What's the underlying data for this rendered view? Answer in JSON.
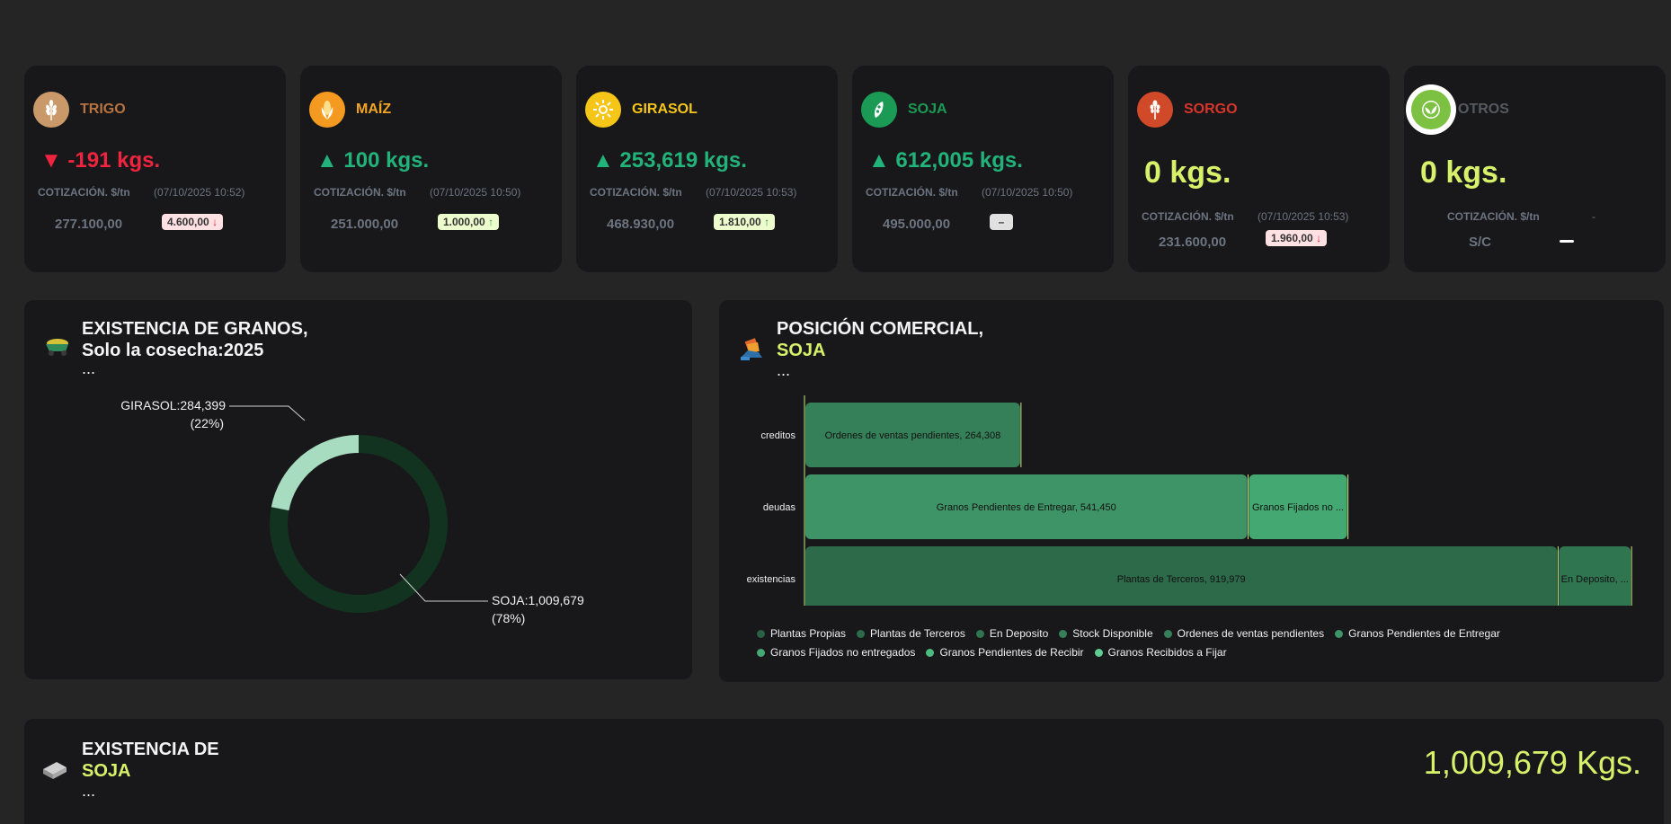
{
  "grains": [
    {
      "name": "TRIGO",
      "name_color": "#b8733e",
      "icon": "wheat-icon",
      "icon_bg": "#c9996a",
      "delta": "▼ -191 kgs.",
      "delta_dir": "down",
      "cot_label": "COTIZACIÓN. $/tn",
      "cot_date": "(07/10/2025 10:52)",
      "price": "277.100,00",
      "badge": "4.600,00",
      "badge_arrow": "↓",
      "badge_kind": "red"
    },
    {
      "name": "MAÍZ",
      "name_color": "#f5a524",
      "icon": "corn-icon",
      "icon_bg": "#f59a20",
      "delta": "▲ 100 kgs.",
      "delta_dir": "up",
      "cot_label": "COTIZACIÓN. $/tn",
      "cot_date": "(07/10/2025 10:50)",
      "price": "251.000,00",
      "badge": "1.000,00",
      "badge_arrow": "↑",
      "badge_kind": "green"
    },
    {
      "name": "GIRASOL",
      "name_color": "#f5c518",
      "icon": "sunflower-icon",
      "icon_bg": "#f5c518",
      "delta": "▲ 253,619 kgs.",
      "delta_dir": "up",
      "cot_label": "COTIZACIÓN. $/tn",
      "cot_date": "(07/10/2025 10:53)",
      "price": "468.930,00",
      "badge": "1.810,00",
      "badge_arrow": "↑",
      "badge_kind": "green"
    },
    {
      "name": "SOJA",
      "name_color": "#1a9a55",
      "icon": "soy-icon",
      "icon_bg": "#1a9a55",
      "delta": "▲ 612,005 kgs.",
      "delta_dir": "up",
      "cot_label": "COTIZACIÓN. $/tn",
      "cot_date": "(07/10/2025 10:50)",
      "price": "495.000,00",
      "badge": "–",
      "badge_arrow": "",
      "badge_kind": "gray"
    },
    {
      "name": "SORGO",
      "name_color": "#d8352a",
      "icon": "sorghum-icon",
      "icon_bg": "#d04a2a",
      "delta": "0 kgs.",
      "delta_dir": "zero",
      "cot_label": "COTIZACIÓN. $/tn",
      "cot_date": "(07/10/2025 10:53)",
      "price": "231.600,00",
      "badge": "1.960,00",
      "badge_arrow": "↓",
      "badge_kind": "red"
    },
    {
      "name": "OTROS",
      "name_color": "#555a60",
      "icon": "leaf-icon",
      "icon_bg": "#7cc142",
      "delta": "0 kgs.",
      "delta_dir": "zero",
      "cot_label": "COTIZACIÓN. $/tn",
      "cot_date": "-",
      "price": "S/C",
      "badge": "",
      "badge_arrow": "",
      "badge_kind": "none"
    }
  ],
  "existencia_panel": {
    "title_line1": "EXISTENCIA DE GRANOS,",
    "title_line2": "Solo la cosecha:2025",
    "ellipsis": "..."
  },
  "posicion_panel": {
    "title_line1": "POSICIÓN COMERCIAL,",
    "title_line2": "SOJA",
    "ellipsis": "..."
  },
  "soja_panel": {
    "title_line1": "EXISTENCIA DE",
    "title_line2": "SOJA",
    "ellipsis": "...",
    "total": "1,009,679 Kgs."
  },
  "colors": {
    "accent": "#d7f26a",
    "card_bg": "#18181b",
    "page_bg": "#252526"
  },
  "chart_data": [
    {
      "type": "pie",
      "variant": "donut",
      "slices": [
        {
          "label": "GIRASOL",
          "value": 284399,
          "label_text": "GIRASOL:284,399",
          "pct_text": "(22%)",
          "color": "#a7dcc0"
        },
        {
          "label": "SOJA",
          "value": 1009679,
          "label_text": "SOJA:1,009,679",
          "pct_text": "(78%)",
          "color": "#12331f"
        }
      ]
    },
    {
      "type": "bar",
      "orientation": "horizontal",
      "stacked": true,
      "categories": [
        "creditos",
        "deudas",
        "existencias"
      ],
      "max_value": 1015000,
      "segments": [
        {
          "category": "creditos",
          "series": "Ordenes de ventas pendientes",
          "value": 264308,
          "label": "Ordenes de ventas pendientes, 264,308",
          "color": "#358059"
        },
        {
          "category": "deudas",
          "series": "Granos Pendientes de Entregar",
          "value": 541450,
          "label": "Granos Pendientes de Entregar, 541,450",
          "color": "#3f9467"
        },
        {
          "category": "deudas",
          "series": "Granos Fijados no entregados",
          "value": 122000,
          "label": "Granos Fijados no ...",
          "color": "#44a872"
        },
        {
          "category": "existencias",
          "series": "Plantas de Terceros",
          "value": 919979,
          "label": "Plantas de Terceros, 919,979",
          "color": "#2c6a4a"
        },
        {
          "category": "existencias",
          "series": "En Deposito",
          "value": 89700,
          "label": "En Deposito, ...",
          "color": "#2f7550"
        }
      ],
      "legend": [
        {
          "name": "Plantas Propias",
          "color": "#2a6044"
        },
        {
          "name": "Plantas de Terceros",
          "color": "#2c6a4a"
        },
        {
          "name": "En Deposito",
          "color": "#2f7550"
        },
        {
          "name": "Stock Disponible",
          "color": "#358059"
        },
        {
          "name": "Ordenes de ventas pendientes",
          "color": "#358059"
        },
        {
          "name": "Granos Pendientes de Entregar",
          "color": "#3f9467"
        },
        {
          "name": "Granos Fijados no entregados",
          "color": "#44a872"
        },
        {
          "name": "Granos Pendientes de Recibir",
          "color": "#4cbb80"
        },
        {
          "name": "Granos Recibidos a Fijar",
          "color": "#5fcc92"
        }
      ]
    }
  ]
}
